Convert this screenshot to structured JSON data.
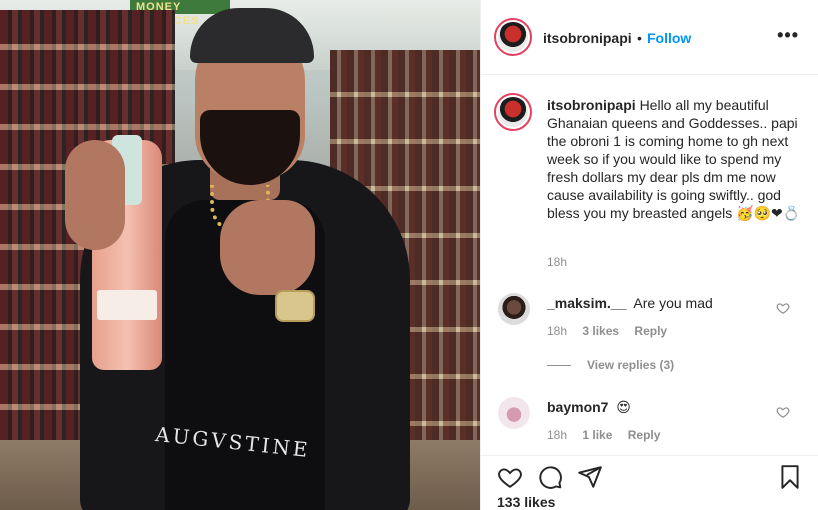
{
  "post": {
    "author": "itsobronipapi",
    "separator": "•",
    "follow_label": "Follow",
    "more_label": "•••",
    "caption_author": "itsobronipapi",
    "caption_text": "Hello all my beautiful Ghanaian queens and Goddesses.. papi the obroni 1 is coming home to gh next week so if you would like to spend my fresh dollars my dear pls dm me now cause availability is going swiftly.. god bless you my breasted angels 🥳🥺❤💍",
    "caption_time": "18h",
    "photo_banner": "MONEY SERVICES",
    "photo_shirt_text": "AUGVSTINE"
  },
  "comments": [
    {
      "user": "_maksim.__",
      "text": "Are you mad",
      "time": "18h",
      "likes": "3 likes",
      "reply": "Reply",
      "view_replies": "View replies (3)"
    },
    {
      "user": "baymon7",
      "text": "😍",
      "time": "18h",
      "likes": "1 like",
      "reply": "Reply"
    }
  ],
  "footer": {
    "likes": "133 likes"
  },
  "icons": {
    "like": "heart-icon",
    "comment": "comment-icon",
    "share": "send-icon",
    "save": "bookmark-icon"
  },
  "colors": {
    "follow": "#0095f6",
    "muted": "#8e8e8e",
    "text": "#262626",
    "story_ring": "#e4405f"
  }
}
